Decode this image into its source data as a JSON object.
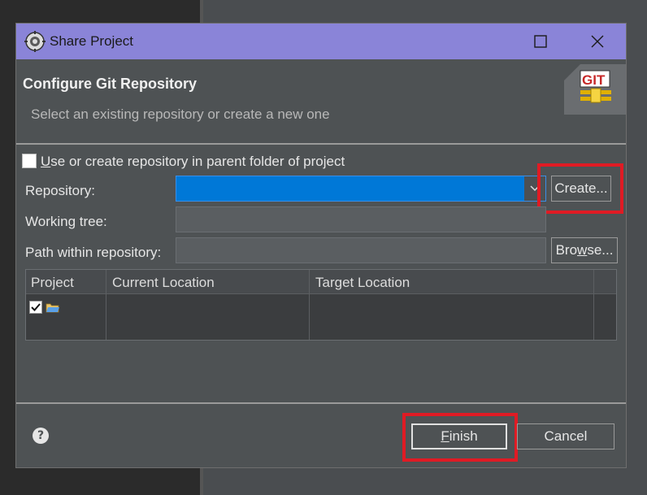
{
  "window": {
    "title": "Share Project",
    "banner_heading": "Configure Git Repository",
    "banner_subtitle": "Select an existing repository or create a new one"
  },
  "form": {
    "use_parent_label_mnemonic": "U",
    "use_parent_label_rest": "se or create repository in parent folder of project",
    "use_parent_checked": false,
    "repository_label": "Repository:",
    "repository_value": "",
    "working_tree_label": "Working tree:",
    "working_tree_value": "",
    "path_label": "Path within repository:",
    "path_value": "",
    "create_button": "Create...",
    "browse_button_pre": "Bro",
    "browse_button_mnemonic": "w",
    "browse_button_post": "se..."
  },
  "table": {
    "columns": [
      "Project",
      "Current Location",
      "Target Location"
    ],
    "rows": [
      {
        "project": "",
        "current": "",
        "target": "",
        "checked": true
      }
    ]
  },
  "footer": {
    "finish_mnemonic": "F",
    "finish_rest": "inish",
    "cancel": "Cancel"
  },
  "logo": {
    "text": "GIT"
  },
  "colors": {
    "titlebar": "#8a84d8",
    "dialog": "#4e5254",
    "selection": "#0078d7",
    "highlight": "#e01b24"
  }
}
